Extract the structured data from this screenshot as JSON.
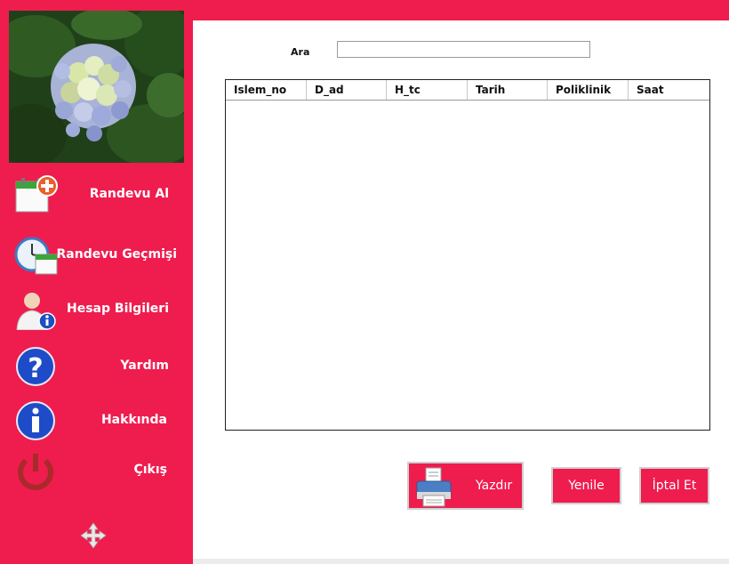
{
  "sidebar": {
    "photo_alt": "",
    "items": [
      {
        "id": "randevu-al",
        "label": "Randevu Al",
        "icon": "calendar-add-icon"
      },
      {
        "id": "randevu-gecmisi",
        "label": "Randevu Geçmişi",
        "icon": "clock-calendar-icon"
      },
      {
        "id": "hesap-bilgileri",
        "label": "Hesap Bilgileri",
        "icon": "user-info-icon"
      },
      {
        "id": "yardim",
        "label": "Yardım",
        "icon": "help-icon"
      },
      {
        "id": "hakkinda",
        "label": "Hakkında",
        "icon": "info-icon"
      },
      {
        "id": "cikis",
        "label": "Çıkış",
        "icon": "power-icon"
      }
    ],
    "move_icon": "move-icon"
  },
  "search": {
    "label": "Ara",
    "value": "",
    "placeholder": ""
  },
  "table": {
    "columns": [
      "Islem_no",
      "D_ad",
      "H_tc",
      "Tarih",
      "Poliklinik",
      "Saat"
    ],
    "rows": []
  },
  "buttons": {
    "print": "Yazdır",
    "refresh": "Yenile",
    "cancel": "İptal Et"
  },
  "colors": {
    "accent": "#ef1c4e",
    "background": "#ffffff"
  }
}
